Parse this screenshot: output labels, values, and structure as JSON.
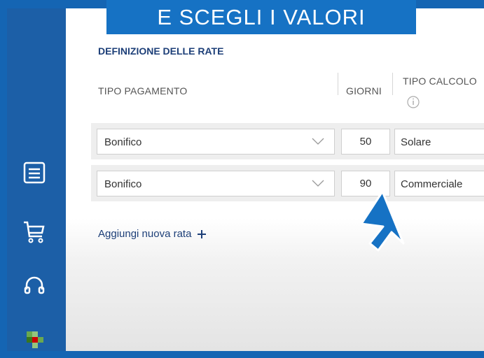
{
  "banner": {
    "text": "E SCEGLI I VALORI"
  },
  "section": {
    "title": "DEFINIZIONE DELLE RATE"
  },
  "columns": {
    "payment_type": "TIPO PAGAMENTO",
    "days": "GIORNI",
    "calc_type": "TIPO CALCOLO"
  },
  "rows": [
    {
      "payment": "Bonifico",
      "days": "50",
      "calc": "Solare"
    },
    {
      "payment": "Bonifico",
      "days": "90",
      "calc": "Commerciale"
    }
  ],
  "actions": {
    "add_installment": "Aggiungi nuova rata"
  },
  "icons": {
    "sidebar": [
      "document-list-icon",
      "cart-icon",
      "headset-icon",
      "logo-icon"
    ],
    "info": "info-icon",
    "dropdown": "chevron-down-icon",
    "add": "plus-icon",
    "pointer": "arrow-cursor-icon"
  },
  "colors": {
    "brand_blue": "#1d5fa8",
    "banner_blue": "#1672c4",
    "link_navy": "#1d3f78"
  }
}
